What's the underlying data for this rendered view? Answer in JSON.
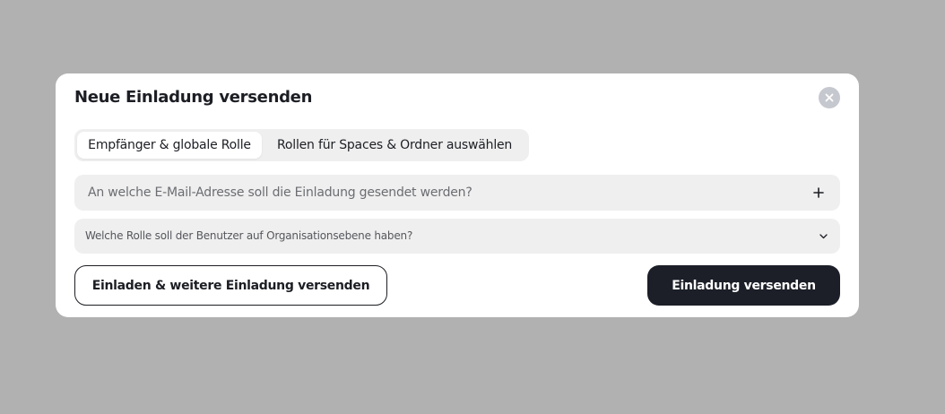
{
  "modal": {
    "title": "Neue Einladung versenden",
    "close_icon": "close-icon"
  },
  "tabs": [
    {
      "label": "Empfänger & globale Rolle",
      "active": true
    },
    {
      "label": "Rollen für Spaces & Ordner auswählen",
      "active": false
    }
  ],
  "email": {
    "value": "",
    "placeholder": "An welche E-Mail-Adresse soll die Einladung gesendet werden?",
    "add_icon": "plus-icon"
  },
  "role": {
    "placeholder": "Welche Rolle soll der Benutzer auf Organisationsebene haben?",
    "icon": "chevron-down-icon"
  },
  "actions": {
    "invite_more_label": "Einladen & weitere Einladung versenden",
    "send_label": "Einladung versenden"
  },
  "colors": {
    "backdrop": "#b1b1b1",
    "primary": "#1c1f28",
    "field_bg": "#efefef"
  }
}
